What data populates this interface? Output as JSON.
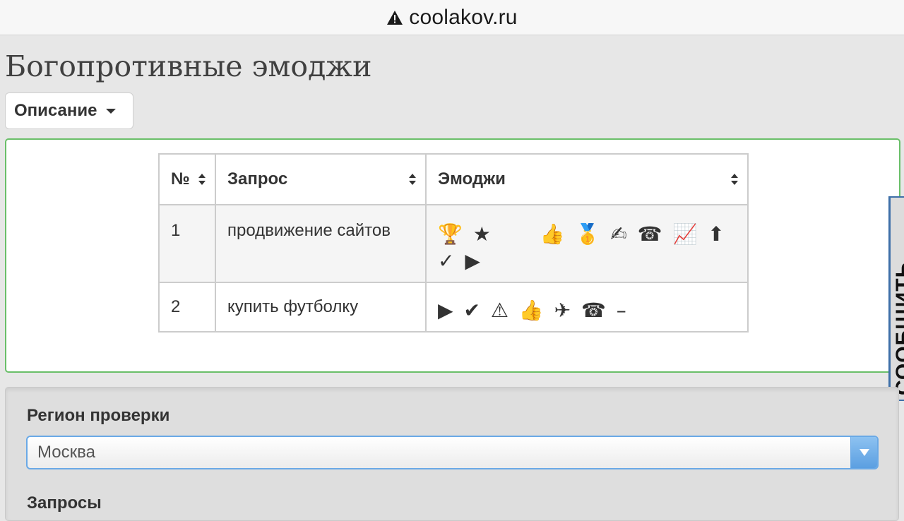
{
  "browser": {
    "url": "coolakov.ru"
  },
  "page": {
    "title": "Богопротивные эмоджи",
    "description_button": "Описание"
  },
  "table": {
    "headers": {
      "num": "№",
      "query": "Запрос",
      "emoji": "Эмоджи"
    },
    "rows": [
      {
        "num": "1",
        "query": "продвижение сайтов",
        "emojis": [
          "🏆",
          "★",
          "",
          "👍",
          "🥇",
          "✍",
          "☎",
          "📈",
          "⬆",
          "✓",
          "▶"
        ]
      },
      {
        "num": "2",
        "query": "купить футболку",
        "emojis": [
          "▶",
          "✔",
          "⚠",
          "👍",
          "✈",
          "☎",
          "–"
        ]
      }
    ]
  },
  "side_tab": {
    "label": "СООБЩИТЬ"
  },
  "form": {
    "region_label": "Регион проверки",
    "region_value": "Москва",
    "queries_label": "Запросы"
  },
  "colors": {
    "panel_border": "#6abf69",
    "select_border": "#6aa9e6",
    "side_tab_border": "#3d6fa8"
  }
}
